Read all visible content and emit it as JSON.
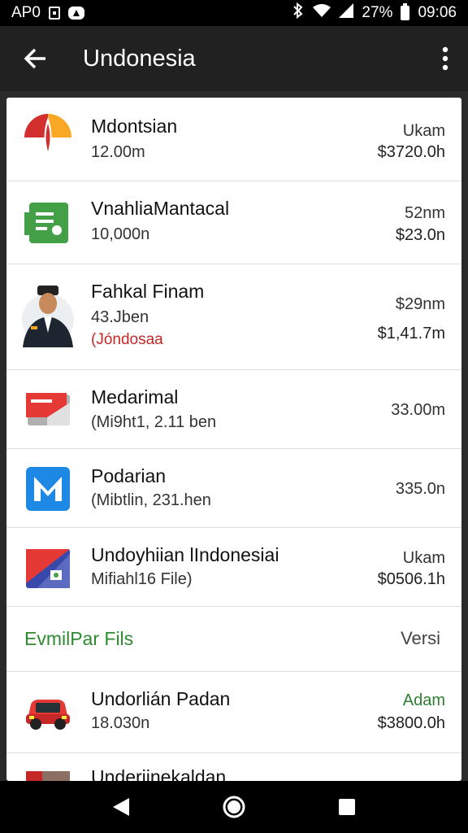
{
  "status_bar": {
    "carrier": "AP0",
    "battery": "27%",
    "time": "09:06"
  },
  "app_bar": {
    "title": "Undonesia"
  },
  "rows": [
    {
      "name": "Mdontsian",
      "sub": "12.00m",
      "right_top": "Ukam",
      "right_bottom": "$3720.0h"
    },
    {
      "name": "VnahliaMantacal",
      "sub": "10,000n",
      "right_top": "52nm",
      "right_bottom": "$23.0n"
    },
    {
      "name": "Fahkal Finam",
      "sub": "43.Jben",
      "sub2": "(Jóndosaa",
      "right_top": "$29nm",
      "right_bottom": "$1,41.7m"
    },
    {
      "name": "Medarimal",
      "sub": "(Mi9ht1, 2.11 ben",
      "right_top": "33.00m"
    },
    {
      "name": "Podarian",
      "sub": "(Mibtlin, 231.hen",
      "right_top": "335.0n"
    },
    {
      "name": "Undoyhiian lIndonesiai",
      "sub": "Mifiahl16 File)",
      "right_top": "Ukam",
      "right_bottom": "$0506.1h"
    },
    {
      "name": "Undorlián Padan",
      "sub": "18.030n",
      "right_top": "Adam",
      "right_bottom": "$3800.0h"
    },
    {
      "name": "Underiinekaldan"
    }
  ],
  "section": {
    "title": "EvmilPar Fils",
    "action": "Versi"
  },
  "colors": {
    "status_bar_bg": "#000000",
    "app_bar_bg": "#212121",
    "card_bg": "#ffffff",
    "section_title": "#2e8b2e",
    "warning_text": "#c62828",
    "accent_green": "#2e7d32"
  },
  "icons": {
    "back": "arrow-back-icon",
    "menu": "more-vert-icon",
    "nav_back": "triangle-back-icon",
    "nav_home": "circle-home-icon",
    "nav_recents": "square-recents-icon"
  }
}
